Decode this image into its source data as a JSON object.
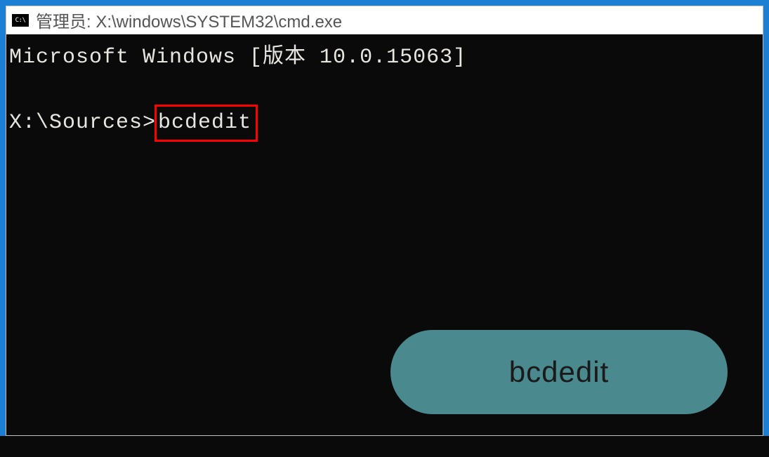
{
  "window": {
    "icon_label": "C:\\",
    "title": "管理员: X:\\windows\\SYSTEM32\\cmd.exe"
  },
  "console": {
    "version_line": "Microsoft Windows [版本 10.0.15063]",
    "prompt": "X:\\Sources>",
    "command": "bcdedit"
  },
  "annotation": {
    "label": "bcdedit"
  }
}
